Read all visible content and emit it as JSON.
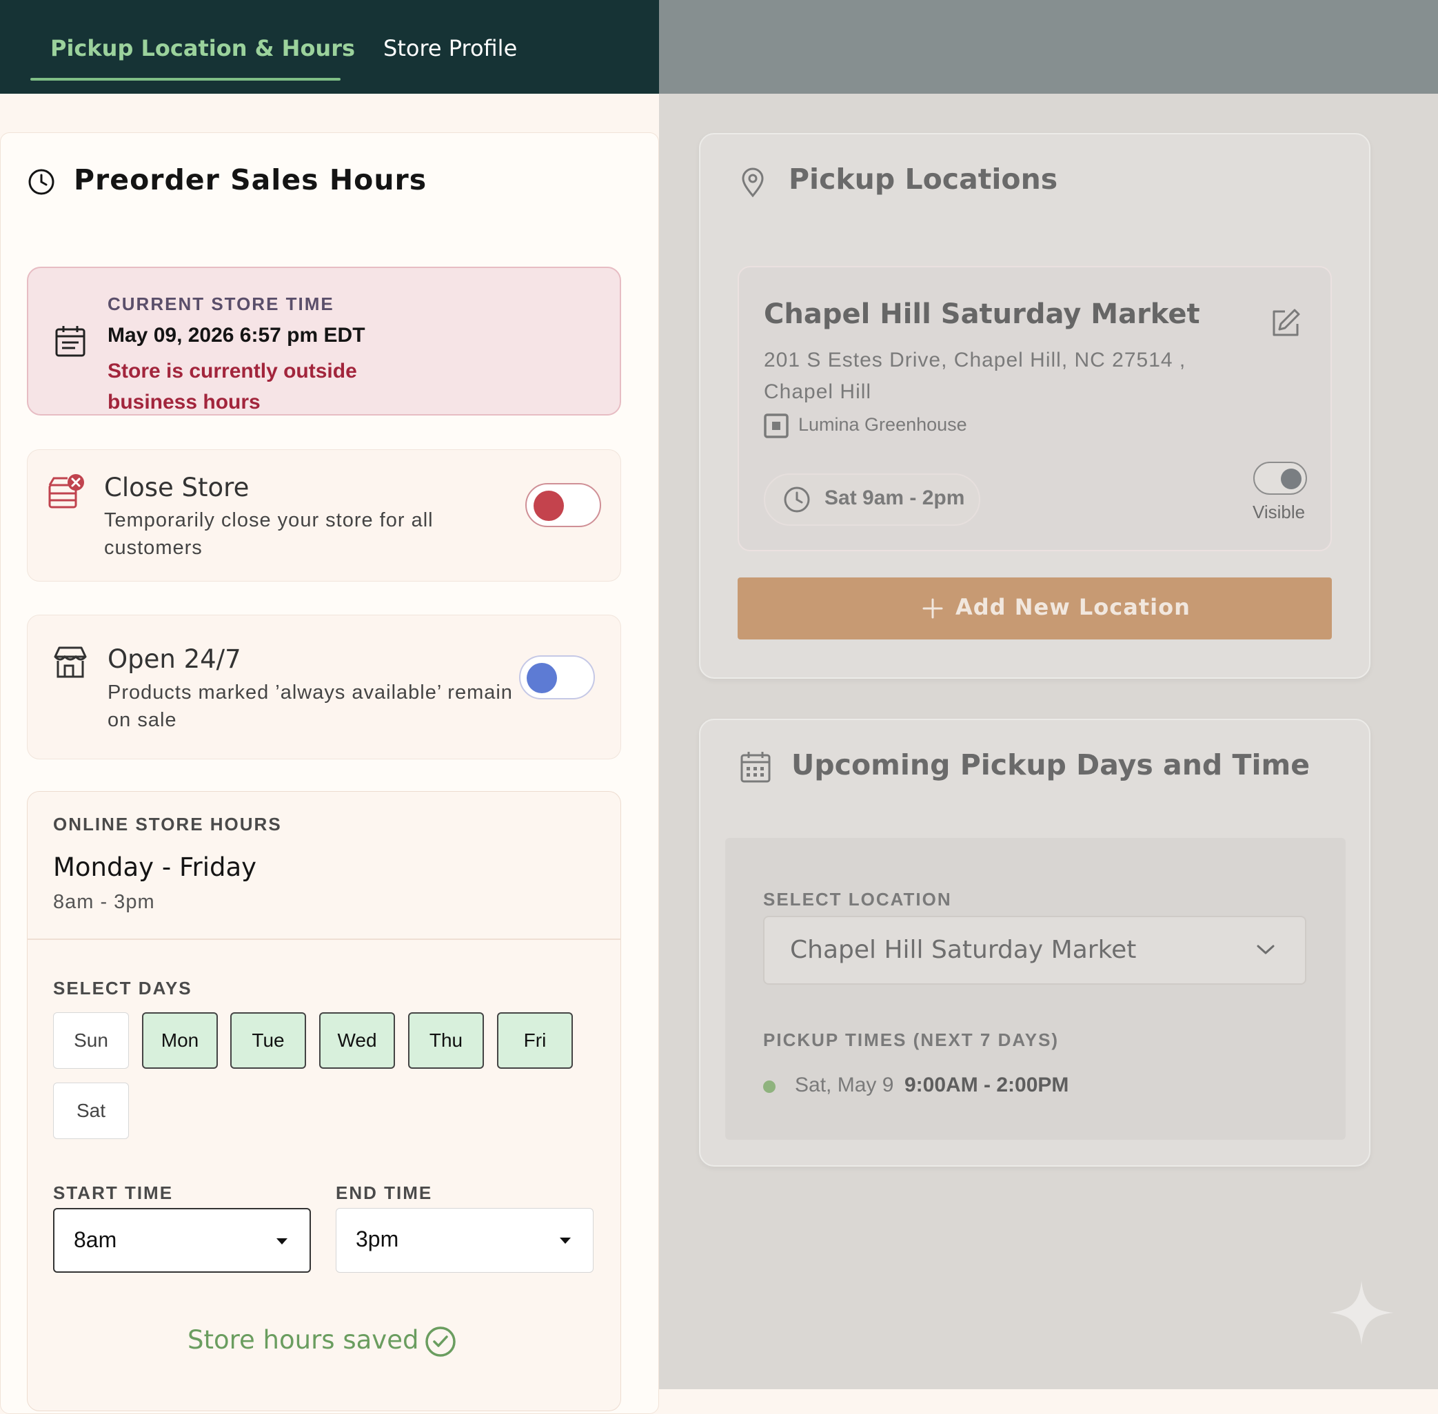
{
  "tabs": {
    "pickup_hours": "Pickup Location & Hours",
    "store_profile": "Store Profile"
  },
  "preorder": {
    "title": "Preorder Sales Hours",
    "current_time_label": "CURRENT STORE TIME",
    "current_time_value": "May 09, 2026 6:57 pm EDT",
    "status": "Store is currently outside business hours"
  },
  "close_store": {
    "title": "Close Store",
    "description": "Temporarily close your store for all customers"
  },
  "open_247": {
    "title": "Open 24/7",
    "description": "Products marked ’always available’ remain on sale"
  },
  "online_hours": {
    "label": "ONLINE STORE HOURS",
    "days": "Monday - Friday",
    "time": "8am - 3pm",
    "select_days_label": "SELECT DAYS",
    "days_list": [
      {
        "label": "Sun",
        "selected": false
      },
      {
        "label": "Mon",
        "selected": true
      },
      {
        "label": "Tue",
        "selected": true
      },
      {
        "label": "Wed",
        "selected": true
      },
      {
        "label": "Thu",
        "selected": true
      },
      {
        "label": "Fri",
        "selected": true
      },
      {
        "label": "Sat",
        "selected": false
      }
    ],
    "start_label": "START TIME",
    "start_value": "8am",
    "end_label": "END TIME",
    "end_value": "3pm",
    "saved_message": "Store hours saved"
  },
  "pickup_locations": {
    "title": "Pickup Locations",
    "location": {
      "name": "Chapel Hill Saturday Market",
      "address": "201 S Estes Drive, Chapel Hill, NC 27514 , Chapel Hill",
      "vendor": "Lumina Greenhouse",
      "hours": "Sat 9am - 2pm",
      "visible_label": "Visible"
    },
    "add_button": "Add New Location"
  },
  "upcoming": {
    "title": "Upcoming Pickup Days and Time",
    "select_location_label": "SELECT LOCATION",
    "selected_location": "Chapel Hill Saturday Market",
    "pickup_times_label": "PICKUP TIMES (NEXT 7 DAYS)",
    "times": [
      {
        "day": "Sat, May 9",
        "time": "9:00AM - 2:00PM"
      }
    ]
  },
  "colors": {
    "topbar": "#163335",
    "active_tab": "#9bd29c",
    "status_red": "#a2253c",
    "close_toggle": "#c4434d",
    "open_toggle": "#5d7bd4",
    "selected_day": "#d8f0dc",
    "saved_green": "#6a9d5f",
    "add_button": "#c79a73"
  }
}
